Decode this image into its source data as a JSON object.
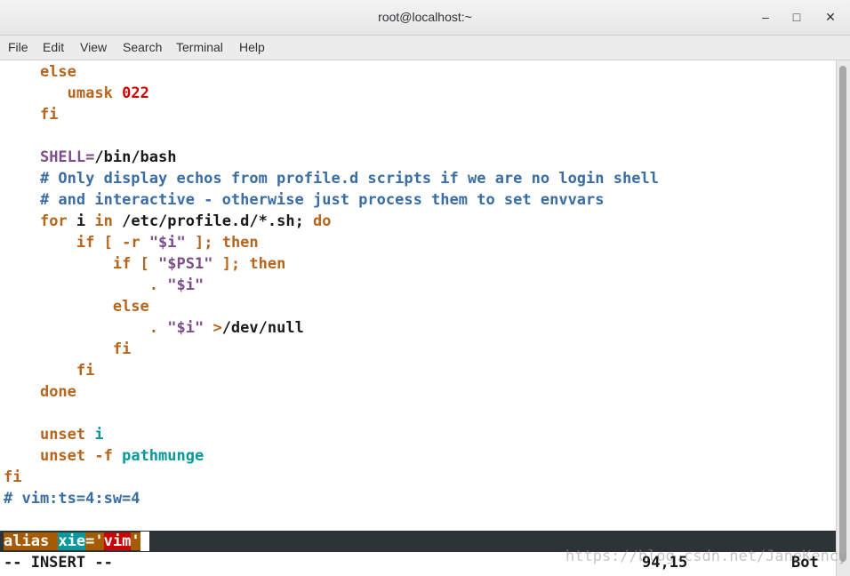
{
  "window": {
    "title": "root@localhost:~"
  },
  "window_controls": {
    "minimize": "–",
    "maximize": "□",
    "close": "✕"
  },
  "menu": [
    "File",
    "Edit",
    "View",
    "Search",
    "Terminal",
    "Help"
  ],
  "code": {
    "l1": "else",
    "l2a": "umask",
    "l2b": "022",
    "l3": "fi",
    "l5a": "SHELL=",
    "l5b": "/bin/bash",
    "l6": "# Only display echos from profile.d scripts if we are no login shell",
    "l7": "# and interactive - otherwise just process them to set envvars",
    "l8a": "for",
    "l8b": " i ",
    "l8c": "in",
    "l8d": " /etc/profile.d/*.sh; ",
    "l8e": "do",
    "l9a": "if",
    "l9b": " [ ",
    "l9c": "-r",
    "l9d": " \"$i\" ",
    "l9e": "]; then",
    "l10a": "if",
    "l10b": " [ ",
    "l10c": "\"$PS1\"",
    "l10d": " ]; ",
    "l10e": "then",
    "l11a": ". ",
    "l11b": "\"$i\"",
    "l12": "else",
    "l13a": ". ",
    "l13b": "\"$i\"",
    "l13c": " >",
    "l13d": "/dev/null",
    "l14": "fi",
    "l15": "fi",
    "l16": "done",
    "l18a": "unset",
    "l18b": " i",
    "l19a": "unset",
    "l19b": " -f",
    "l19c": " pathmunge",
    "l20": "fi",
    "l21": "# vim:ts=4:sw=4"
  },
  "cmdline": {
    "p1": "alias",
    "p2": "xie",
    "p3": "='",
    "p4": "vim",
    "p5": "'"
  },
  "status": {
    "mode": "-- INSERT --",
    "position": "94,15",
    "scroll": "Bot"
  },
  "watermark": "https://blog.csdn.net/JaneKency"
}
